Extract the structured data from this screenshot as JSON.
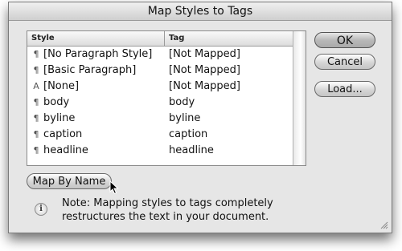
{
  "window": {
    "title": "Map Styles to Tags"
  },
  "table": {
    "col_style": "Style",
    "col_tag": "Tag",
    "rows": [
      {
        "icon": "paragraph-icon",
        "style": "[No Paragraph Style]",
        "tag": "[Not Mapped]"
      },
      {
        "icon": "paragraph-icon",
        "style": "[Basic Paragraph]",
        "tag": "[Not Mapped]"
      },
      {
        "icon": "character-icon",
        "style": "[None]",
        "tag": "[Not Mapped]"
      },
      {
        "icon": "paragraph-icon",
        "style": "body",
        "tag": "body"
      },
      {
        "icon": "paragraph-icon",
        "style": "byline",
        "tag": "byline"
      },
      {
        "icon": "paragraph-icon",
        "style": "caption",
        "tag": "caption"
      },
      {
        "icon": "paragraph-icon",
        "style": "headline",
        "tag": "headline"
      }
    ]
  },
  "buttons": {
    "ok": "OK",
    "cancel": "Cancel",
    "load": "Load...",
    "map_by_name": "Map By Name"
  },
  "note": "Note: Mapping styles to tags completely restructures the text in your document."
}
